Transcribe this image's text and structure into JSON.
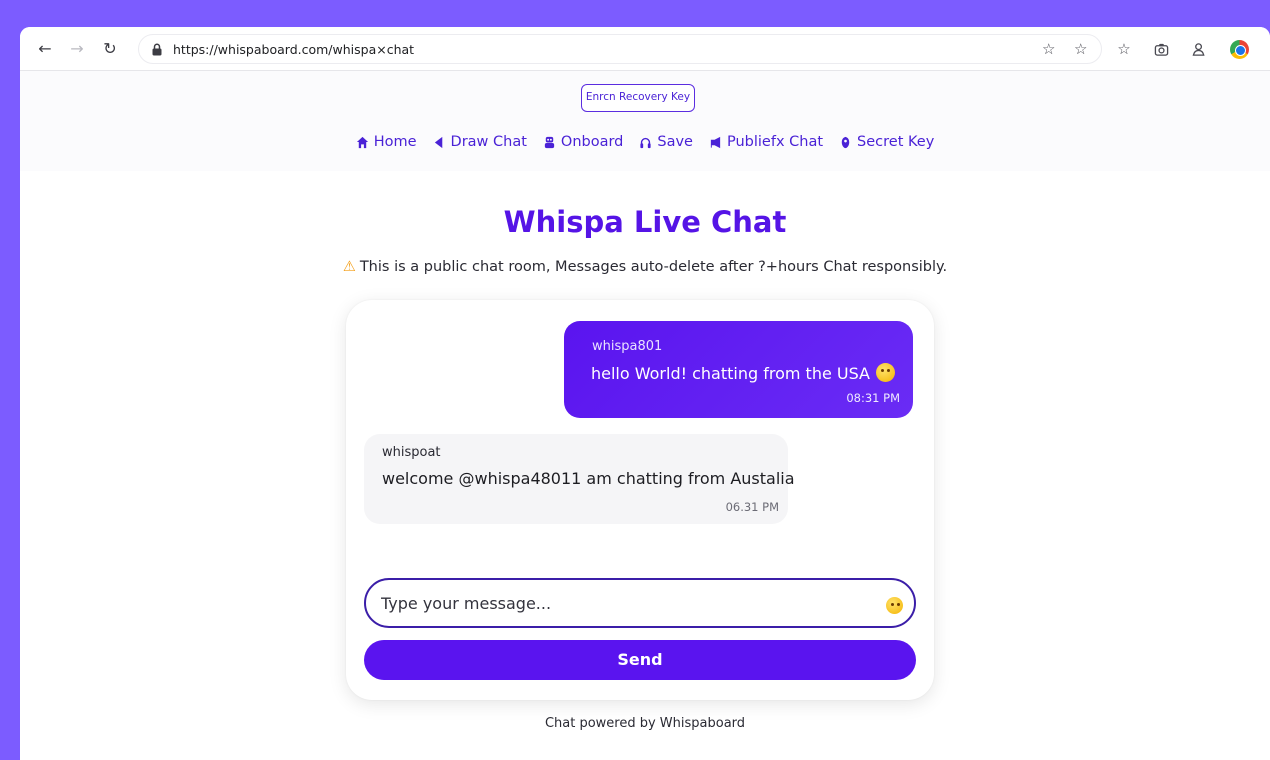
{
  "browser": {
    "url": "https://whispaboard.com/whispa×chat",
    "icons": [
      "back-icon",
      "forward-icon",
      "reload-icon",
      "lock-icon",
      "star-icon",
      "bookmark-icon",
      "camera-icon",
      "profile-icon",
      "chrome-icon"
    ]
  },
  "header": {
    "recovery_button": "Enrcn Recovery Key",
    "nav": [
      {
        "label": "Home",
        "icon": "home-icon"
      },
      {
        "label": "Draw Chat",
        "icon": "pencil-icon"
      },
      {
        "label": "Onboard",
        "icon": "robot-icon"
      },
      {
        "label": "Save",
        "icon": "headphones-icon"
      },
      {
        "label": "Publiefx  Chat",
        "icon": "megaphone-icon"
      },
      {
        "label": "Secret Key",
        "icon": "key-icon"
      }
    ]
  },
  "main": {
    "title": "Whispa Live Chat",
    "notice": "This is a public chat room, Messages auto-delete after ?+hours Chat responsibly."
  },
  "messages": [
    {
      "user": "whispa801",
      "text": "hello World! chatting from the USA",
      "time": "08:31 PM",
      "outgoing": true
    },
    {
      "user": "whispoat",
      "text": "welcome @whispa48011 am chatting from Austalia",
      "time": "06.31 PM",
      "outgoing": false
    }
  ],
  "composer": {
    "placeholder": "Type your message...",
    "send_label": "Send"
  },
  "footer": {
    "text": "Chat powered by Whispaboard"
  },
  "colors": {
    "accent": "#5a14ef",
    "background": "#7c5cff",
    "warning": "#f39c12"
  }
}
